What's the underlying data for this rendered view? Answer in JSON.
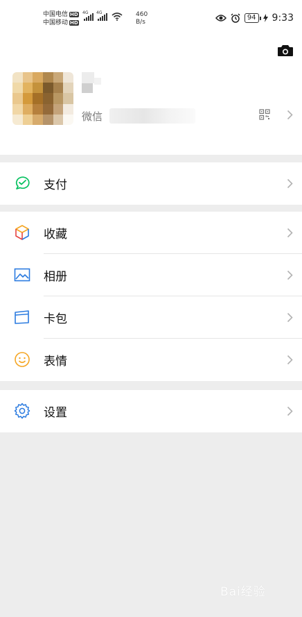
{
  "status_bar": {
    "carrier1": "中国电信",
    "carrier2": "中国移动",
    "hd": "HD",
    "net_type": "4G",
    "speed_value": "460",
    "speed_unit": "B/s",
    "battery": "94",
    "time": "9:33"
  },
  "profile": {
    "wechat_label": "微信"
  },
  "menu": {
    "pay": "支付",
    "favorites": "收藏",
    "album": "相册",
    "cards": "卡包",
    "stickers": "表情",
    "settings": "设置"
  },
  "colors": {
    "pay_green": "#07c160",
    "blue": "#2b7be0",
    "sticker_orange": "#f5a623"
  },
  "watermark": "Bai经验"
}
